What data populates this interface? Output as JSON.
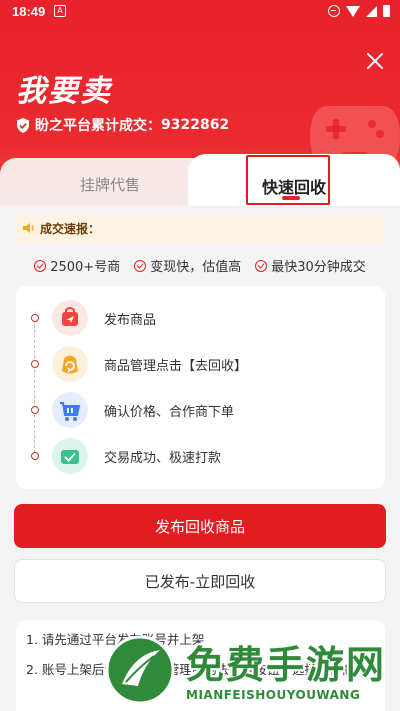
{
  "status_bar": {
    "time": "18:49",
    "app_icon": "A"
  },
  "header": {
    "title": "我要卖",
    "subtitle_prefix": "盼之平台累计成交：",
    "deal_count": "9322862"
  },
  "tabs": [
    {
      "label": "挂牌代售",
      "active": false
    },
    {
      "label": "快速回收",
      "active": true
    }
  ],
  "news": {
    "label": "成交速报："
  },
  "features": [
    {
      "label": "2500+号商"
    },
    {
      "label": "变现快，估值高"
    },
    {
      "label": "最快30分钟成交"
    }
  ],
  "steps": [
    {
      "label": "发布商品",
      "icon": "send-bag-icon",
      "color": "#f2453d"
    },
    {
      "label": "商品管理点击【去回收】",
      "icon": "recycle-icon",
      "color": "#f5a623"
    },
    {
      "label": "确认价格、合作商下单",
      "icon": "cart-icon",
      "color": "#3d7cf2"
    },
    {
      "label": "交易成功、极速打款",
      "icon": "wallet-check-icon",
      "color": "#34c38f"
    }
  ],
  "buttons": {
    "primary": "发布回收商品",
    "secondary": "已发布-立即回收"
  },
  "notes": [
    "1. 请先通过平台发布账号并上架",
    "2. 账号上架后请点击商品管理中的去回收按钮，选择合作商"
  ],
  "watermark": {
    "text": "免费手游网",
    "pinyin": "MIANFEISHOUYOUWANG"
  },
  "colors": {
    "brand_red": "#e8222a",
    "news_bg": "#fdf3e2"
  }
}
